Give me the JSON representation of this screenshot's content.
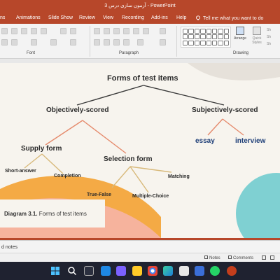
{
  "window": {
    "title": "آزمون سازی درس 3  -  PowerPoint"
  },
  "tabs": [
    "ns",
    "Animations",
    "Slide Show",
    "Review",
    "View",
    "Recording",
    "Add-ins",
    "Help"
  ],
  "tell_me": "Tell me what you want to do",
  "ribbon": {
    "groups": {
      "font": "Font",
      "paragraph": "Paragraph",
      "drawing": "Drawing"
    },
    "arrange": "Arrange",
    "quick_styles": "Quick Styles",
    "side_items": [
      "Sh",
      "Sh",
      "Sh"
    ]
  },
  "diagram": {
    "root": "Forms of test  items",
    "objectively": "Objectively-scored",
    "subjectively": "Subjectively-scored",
    "supply": "Supply form",
    "selection": "Selection form",
    "essay": "essay",
    "interview": "interview",
    "short_answer": "Short-answer",
    "completion": "Completion",
    "matching": "Matching",
    "true_false": "True-False",
    "multiple_choice": "Multiple-Choice",
    "caption_prefix": "Diagram 3.1.",
    "caption_text": " Forms of test items"
  },
  "notes_placeholder": "d notes",
  "status": {
    "notes": "Notes",
    "comments": "Comments"
  },
  "colors": {
    "accent": "#b7472a",
    "connector_dark": "#3a3a3a",
    "connector_salmon": "#e58a6c",
    "connector_tan": "#d8b97a",
    "subject_blue": "#1f3f78"
  }
}
